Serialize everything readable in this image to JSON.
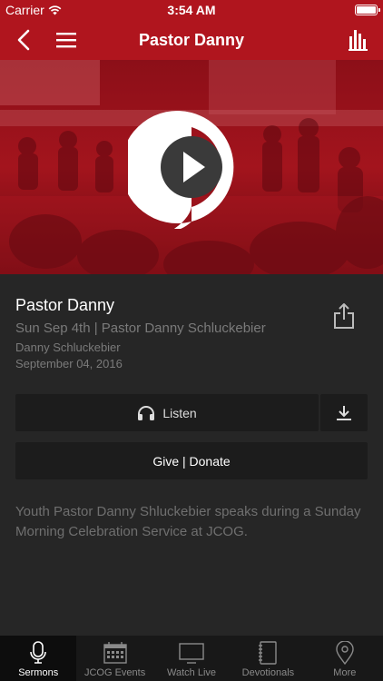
{
  "status_bar": {
    "carrier": "Carrier",
    "time": "3:54 AM"
  },
  "nav": {
    "title": "Pastor Danny"
  },
  "colors": {
    "brand": "#b0151e",
    "background": "#262626",
    "button": "#1c1c1c",
    "muted_text": "#7a7a7a"
  },
  "sermon": {
    "title": "Pastor Danny",
    "subtitle": "Sun Sep 4th | Pastor Danny Schluckebier",
    "speaker": "Danny Schluckebier",
    "date": "September 04, 2016",
    "description": "Youth Pastor Danny Shluckebier speaks during a Sunday Morning Celebration Service at JCOG."
  },
  "actions": {
    "listen_label": "Listen",
    "give_label": "Give | Donate"
  },
  "tabs": [
    {
      "label": "Sermons",
      "icon": "microphone-icon",
      "active": true
    },
    {
      "label": "JCOG Events",
      "icon": "calendar-icon",
      "active": false
    },
    {
      "label": "Watch Live",
      "icon": "tv-icon",
      "active": false
    },
    {
      "label": "Devotionals",
      "icon": "notebook-icon",
      "active": false
    },
    {
      "label": "More",
      "icon": "location-pin-icon",
      "active": false
    }
  ]
}
